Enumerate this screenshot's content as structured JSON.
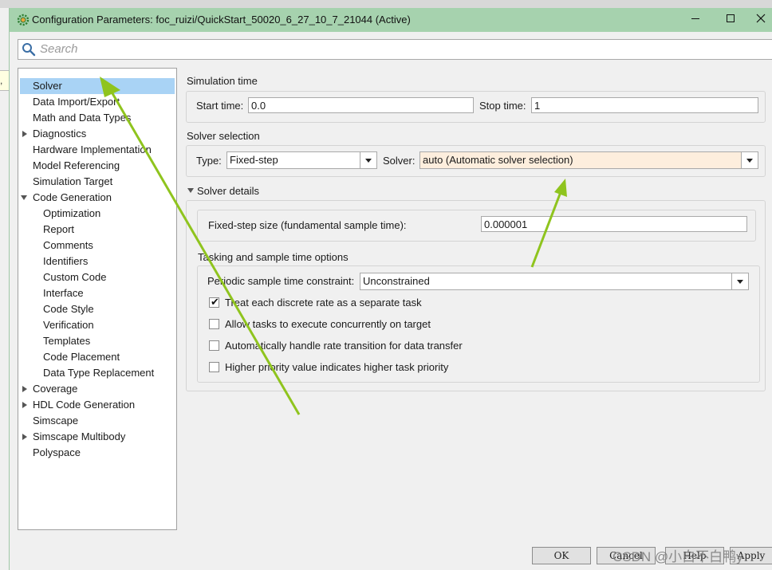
{
  "background": {
    "tooltip_fragment": ", c"
  },
  "window": {
    "title": "Configuration Parameters: foc_ruizi/QuickStart_50020_6_27_10_7_21044 (Active)",
    "titlebar_color": "#a6d2ae",
    "icon": "settings-gear-icon"
  },
  "search": {
    "placeholder": "Search"
  },
  "tree": {
    "selected_color": "#a9d3f5",
    "items": [
      {
        "label": "Solver",
        "level": 0,
        "expander": "none",
        "selected": true
      },
      {
        "label": "Data Import/Export",
        "level": 0,
        "expander": "none"
      },
      {
        "label": "Math and Data Types",
        "level": 0,
        "expander": "none"
      },
      {
        "label": "Diagnostics",
        "level": 0,
        "expander": "collapsed"
      },
      {
        "label": "Hardware Implementation",
        "level": 0,
        "expander": "none"
      },
      {
        "label": "Model Referencing",
        "level": 0,
        "expander": "none"
      },
      {
        "label": "Simulation Target",
        "level": 0,
        "expander": "none"
      },
      {
        "label": "Code Generation",
        "level": 0,
        "expander": "expanded"
      },
      {
        "label": "Optimization",
        "level": 1,
        "expander": "none"
      },
      {
        "label": "Report",
        "level": 1,
        "expander": "none"
      },
      {
        "label": "Comments",
        "level": 1,
        "expander": "none"
      },
      {
        "label": "Identifiers",
        "level": 1,
        "expander": "none"
      },
      {
        "label": "Custom Code",
        "level": 1,
        "expander": "none"
      },
      {
        "label": "Interface",
        "level": 1,
        "expander": "none"
      },
      {
        "label": "Code Style",
        "level": 1,
        "expander": "none"
      },
      {
        "label": "Verification",
        "level": 1,
        "expander": "none"
      },
      {
        "label": "Templates",
        "level": 1,
        "expander": "none"
      },
      {
        "label": "Code Placement",
        "level": 1,
        "expander": "none"
      },
      {
        "label": "Data Type Replacement",
        "level": 1,
        "expander": "none"
      },
      {
        "label": "Coverage",
        "level": 0,
        "expander": "collapsed"
      },
      {
        "label": "HDL Code Generation",
        "level": 0,
        "expander": "collapsed"
      },
      {
        "label": "Simscape",
        "level": 0,
        "expander": "none"
      },
      {
        "label": "Simscape Multibody",
        "level": 0,
        "expander": "collapsed"
      },
      {
        "label": "Polyspace",
        "level": 0,
        "expander": "none"
      }
    ]
  },
  "simulation_time": {
    "heading": "Simulation time",
    "start_label": "Start time:",
    "start_value": "0.0",
    "stop_label": "Stop time:",
    "stop_value": "1"
  },
  "solver_selection": {
    "heading": "Solver selection",
    "type_label": "Type:",
    "type_value": "Fixed-step",
    "solver_label": "Solver:",
    "solver_value": "auto (Automatic solver selection)",
    "solver_bg": "#fdeedd"
  },
  "solver_details": {
    "heading": "Solver details",
    "step_size_label": "Fixed-step size (fundamental sample time):",
    "step_size_value": "0.000001",
    "tasking_heading": "Tasking and sample time options",
    "periodic_label": "Periodic sample time constraint:",
    "periodic_value": "Unconstrained",
    "checkboxes": [
      {
        "label": "Treat each discrete rate as a separate task",
        "checked": true
      },
      {
        "label": "Allow tasks to execute concurrently on target",
        "checked": false
      },
      {
        "label": "Automatically handle rate transition for data transfer",
        "checked": false
      },
      {
        "label": "Higher priority value indicates higher task priority",
        "checked": false
      }
    ]
  },
  "footer": {
    "ok_label": "OK",
    "cancel_label": "Cancel",
    "help_label": "Help",
    "apply_label": "Apply",
    "watermark": "CSDN @小白不白鸭y"
  },
  "annotations": {
    "arrow_color": "#8fc41e"
  }
}
